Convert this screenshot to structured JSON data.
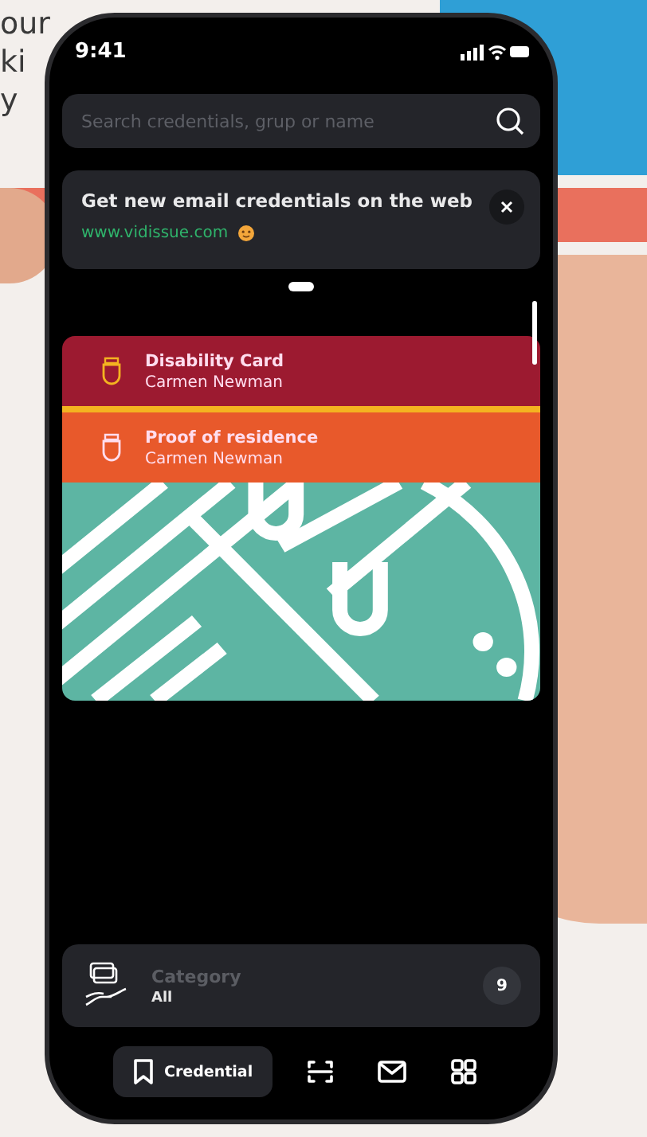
{
  "background_text": [
    "our",
    "ki",
    "y"
  ],
  "status_bar": {
    "time": "9:41"
  },
  "search": {
    "placeholder": "Search credentials, grup or name"
  },
  "banner": {
    "title": "Get new email credentials on the web",
    "link": "www.vidissue.com"
  },
  "pager": [
    {
      "selected": true
    }
  ],
  "cards": [
    {
      "title": "Disability Card",
      "holder": "Carmen Newman",
      "color": "#9c1a30"
    },
    {
      "title": "Proof of residence",
      "holder": "Carmen Newman",
      "color": "#e8592b"
    }
  ],
  "category": {
    "label": "Category",
    "value": "All",
    "count": "9"
  },
  "nav": [
    {
      "kind": "credential",
      "label": "Credential",
      "selected": true
    },
    {
      "kind": "scan",
      "selected": false
    },
    {
      "kind": "mail",
      "selected": false
    },
    {
      "kind": "apps",
      "selected": false
    }
  ]
}
